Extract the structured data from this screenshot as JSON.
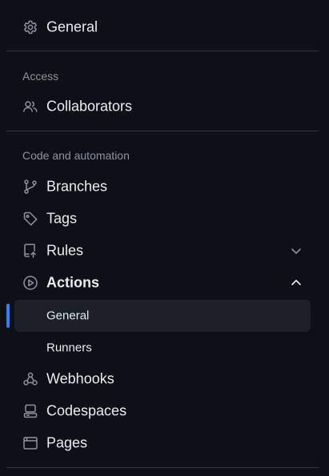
{
  "colors": {
    "background": "#0d1117",
    "text": "#e6edf3",
    "muted": "#8b949e",
    "divider": "#30363d",
    "selected_bg": "#1c2128",
    "accent": "#2f81f7"
  },
  "nav": {
    "general": {
      "label": "General",
      "icon": "gear-icon"
    },
    "access": {
      "heading": "Access",
      "collaborators": {
        "label": "Collaborators",
        "icon": "people-icon"
      }
    },
    "code_automation": {
      "heading": "Code and automation",
      "branches": {
        "label": "Branches",
        "icon": "git-branch-icon"
      },
      "tags": {
        "label": "Tags",
        "icon": "tag-icon"
      },
      "rules": {
        "label": "Rules",
        "icon": "repo-push-icon",
        "chevron": "chevron-down-icon"
      },
      "actions": {
        "label": "Actions",
        "icon": "play-icon",
        "chevron": "chevron-up-icon",
        "expanded": true,
        "children": [
          {
            "label": "General",
            "selected": true
          },
          {
            "label": "Runners",
            "selected": false
          }
        ]
      },
      "webhooks": {
        "label": "Webhooks",
        "icon": "webhook-icon"
      },
      "codespaces": {
        "label": "Codespaces",
        "icon": "codespaces-icon"
      },
      "pages": {
        "label": "Pages",
        "icon": "browser-icon"
      }
    }
  }
}
